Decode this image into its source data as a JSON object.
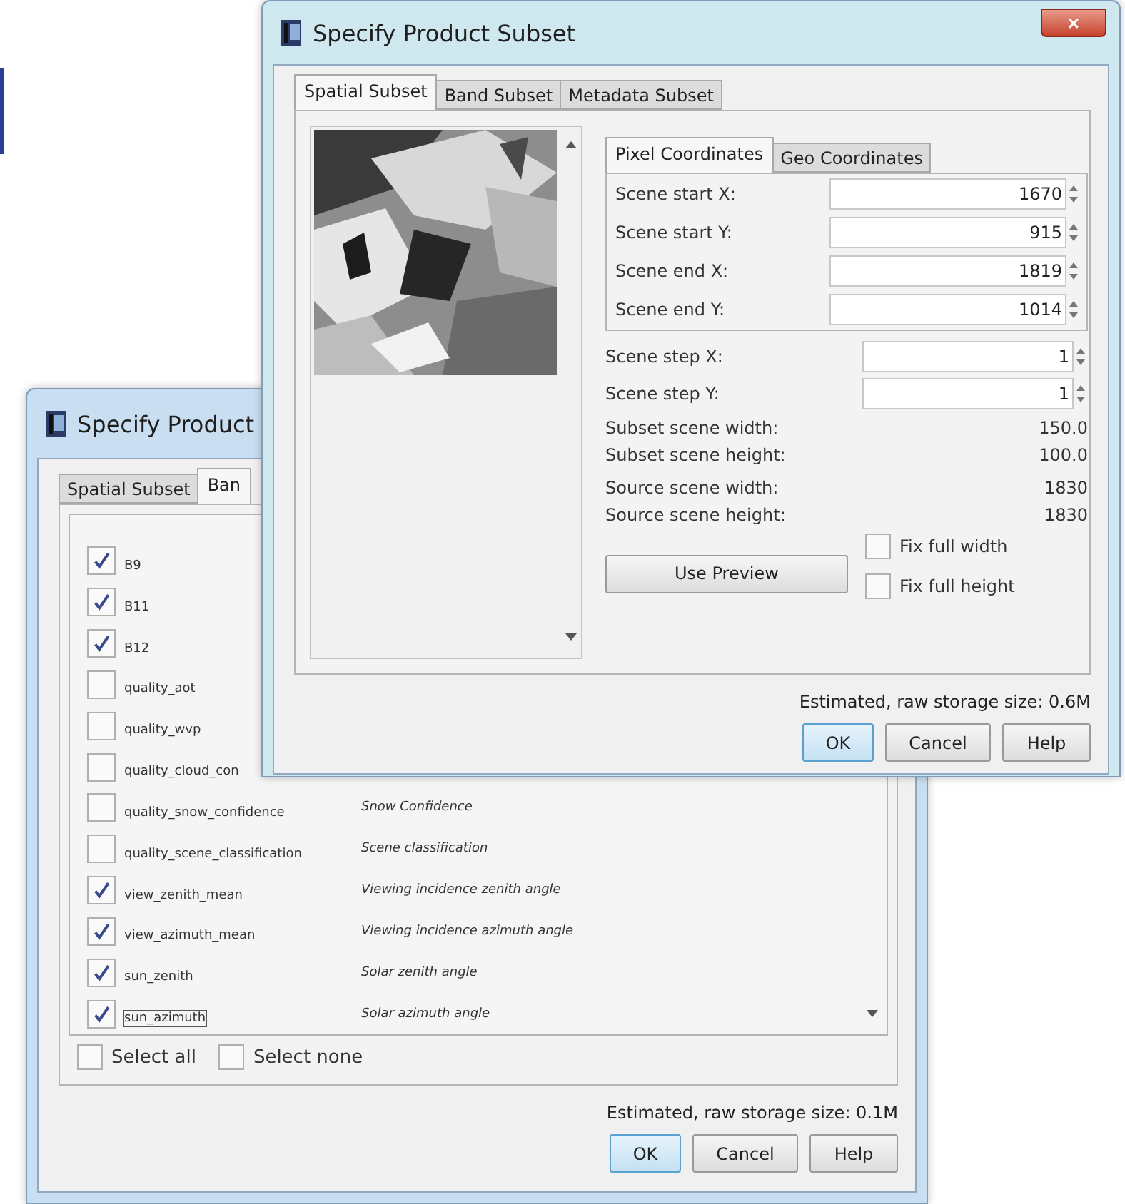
{
  "back_window": {
    "title": "Specify Product",
    "tabs": [
      {
        "label": "Spatial Subset",
        "selected": false
      },
      {
        "label": "Ban",
        "selected": true
      }
    ],
    "bands": [
      {
        "name": "B9",
        "checked": true,
        "focused": false
      },
      {
        "name": "B11",
        "checked": true,
        "focused": false
      },
      {
        "name": "B12",
        "checked": true,
        "focused": false
      },
      {
        "name": "quality_aot",
        "checked": false,
        "focused": false
      },
      {
        "name": "quality_wvp",
        "checked": false,
        "focused": false
      },
      {
        "name": "quality_cloud_con",
        "checked": false,
        "focused": false
      },
      {
        "name": "quality_snow_confidence",
        "description": "Snow Confidence",
        "checked": false,
        "focused": false
      },
      {
        "name": "quality_scene_classification",
        "description": "Scene classification",
        "checked": false,
        "focused": false
      },
      {
        "name": "view_zenith_mean",
        "description": "Viewing incidence zenith angle",
        "checked": true,
        "focused": false
      },
      {
        "name": "view_azimuth_mean",
        "description": "Viewing incidence azimuth angle",
        "checked": true,
        "focused": false
      },
      {
        "name": "sun_zenith",
        "description": "Solar zenith angle",
        "checked": true,
        "focused": false
      },
      {
        "name": "sun_azimuth",
        "description": "Solar azimuth angle",
        "checked": true,
        "focused": true
      }
    ],
    "select_options": [
      {
        "label": "Select all",
        "checked": false
      },
      {
        "label": "Select none",
        "checked": false
      }
    ],
    "storage": "Estimated, raw storage size: 0.1M",
    "buttons": [
      {
        "label": "OK",
        "default": true
      },
      {
        "label": "Cancel",
        "default": false
      },
      {
        "label": "Help",
        "default": false
      }
    ]
  },
  "front_window": {
    "title": "Specify Product Subset",
    "close": "×",
    "tabs": [
      {
        "label": "Spatial Subset",
        "selected": true
      },
      {
        "label": "Band Subset",
        "selected": false
      },
      {
        "label": "Metadata Subset",
        "selected": false
      }
    ],
    "coordinate_tabs": [
      {
        "label": "Pixel Coordinates",
        "selected": true
      },
      {
        "label": "Geo Coordinates",
        "selected": false
      }
    ],
    "coordinate_fields": [
      {
        "label": "Scene start X:",
        "value": "1670"
      },
      {
        "label": "Scene start Y:",
        "value": "915"
      },
      {
        "label": "Scene end X:",
        "value": "1819"
      },
      {
        "label": "Scene end Y:",
        "value": "1014"
      }
    ],
    "step_fields": [
      {
        "label": "Scene step X:",
        "value": "1"
      },
      {
        "label": "Scene step Y:",
        "value": "1"
      }
    ],
    "info": [
      {
        "label": "Subset scene width:",
        "value": "150.0"
      },
      {
        "label": "Subset scene height:",
        "value": "100.0"
      },
      {
        "label": "Source scene width:",
        "value": "1830"
      },
      {
        "label": "Source scene height:",
        "value": "1830"
      }
    ],
    "use_preview": "Use Preview",
    "fix_options": [
      {
        "label": "Fix full width",
        "checked": false
      },
      {
        "label": "Fix full height",
        "checked": false
      }
    ],
    "storage": "Estimated, raw storage size: 0.6M",
    "buttons": [
      {
        "label": "OK",
        "default": true
      },
      {
        "label": "Cancel",
        "default": false
      },
      {
        "label": "Help",
        "default": false
      }
    ]
  }
}
